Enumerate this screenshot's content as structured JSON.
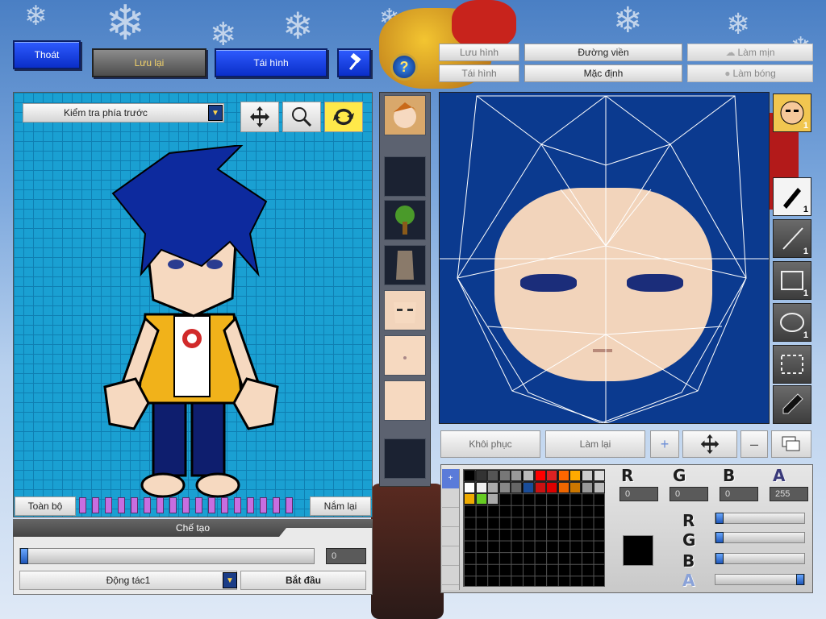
{
  "top_left": {
    "exit_label": "Thoát",
    "save_label": "Lưu lại",
    "reshape_label": "Tái hình",
    "help_symbol": "?"
  },
  "top_right": {
    "save_shape_label": "Lưu hình",
    "outline_label": "Đường viền",
    "smooth_label": "Làm mịn",
    "reshape_label": "Tái hình",
    "default_label": "Mặc định",
    "shine_label": "Làm bóng"
  },
  "preview": {
    "view_select_value": "Kiểm tra phía trước",
    "all_label": "Toàn bộ",
    "hold_label": "Nắm lại",
    "create_header": "Chế tạo",
    "progress_value": "0",
    "progress_fraction": 0.0,
    "action_select_value": "Động tác1",
    "start_label": "Bắt đầu",
    "skin_color": "#f6d9c0",
    "hair_color": "#0d2a9e",
    "shirt_color": "#f1b21a"
  },
  "editor": {
    "restore_label": "Khôi phục",
    "redo_label": "Làm lại",
    "canvas_color": "#0b3a8f",
    "skin_color": "#f2d4bb"
  },
  "tools": [
    {
      "name": "face-icon",
      "count": "1"
    },
    {
      "name": "pen-icon",
      "count": "1"
    },
    {
      "name": "line-icon",
      "count": "1"
    },
    {
      "name": "rectangle-icon",
      "count": "1"
    },
    {
      "name": "ellipse-icon",
      "count": "1"
    },
    {
      "name": "selection-icon",
      "count": ""
    },
    {
      "name": "eyedropper-icon",
      "count": ""
    }
  ],
  "palette": {
    "colors_row1": [
      "#000000",
      "#333333",
      "#555555",
      "#777777",
      "#999999",
      "#bbbbbb",
      "#ff0000",
      "#dd2222",
      "#ff6600",
      "#ffaa00",
      "#cccccc",
      "#dddddd"
    ],
    "colors_row2": [
      "#ffffff",
      "#eeeeee",
      "#aaaaaa",
      "#888888",
      "#666666",
      "#1a4d99",
      "#cc1111",
      "#dd0000",
      "#ee6600",
      "#cc7700",
      "#999999",
      "#bbbbbb"
    ],
    "colors_row3": [
      "#eeaa00",
      "#66cc22",
      "#aaaaaa"
    ],
    "current_color": "#000000"
  },
  "color_values": {
    "r_label": "R",
    "g_label": "G",
    "b_label": "B",
    "a_label": "A",
    "r": "0",
    "g": "0",
    "b": "0",
    "a": "255",
    "r_fraction": 0.0,
    "g_fraction": 0.0,
    "b_fraction": 0.0,
    "a_fraction": 1.0
  }
}
